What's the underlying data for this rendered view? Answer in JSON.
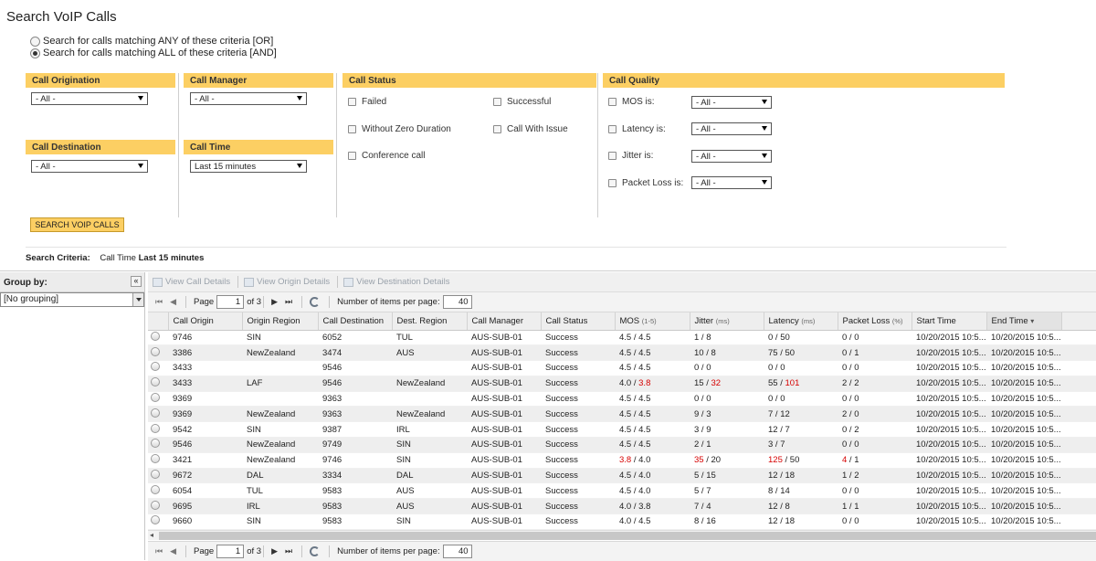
{
  "page": {
    "title": "Search VoIP Calls",
    "match_any": "Search for calls matching ANY of these criteria [OR]",
    "match_all": "Search for calls matching ALL of these criteria [AND]"
  },
  "filters": {
    "origination": {
      "label": "Call Origination",
      "value": "- All -"
    },
    "manager": {
      "label": "Call Manager",
      "value": "- All -"
    },
    "destination": {
      "label": "Call Destination",
      "value": "- All -"
    },
    "time": {
      "label": "Call Time",
      "value": "Last 15 minutes"
    },
    "status": {
      "label": "Call Status",
      "failed": "Failed",
      "successful": "Successful",
      "without_zero": "Without Zero Duration",
      "with_issue": "Call With Issue",
      "conference": "Conference call"
    },
    "quality": {
      "label": "Call Quality",
      "mos": "MOS is:",
      "latency": "Latency is:",
      "jitter": "Jitter is:",
      "packet_loss": "Packet Loss is:",
      "value": "- All -"
    },
    "search_button": "SEARCH VOIP CALLS",
    "criteria_label": "Search Criteria:",
    "criteria_field": "Call Time",
    "criteria_value": "Last 15 minutes"
  },
  "group_by": {
    "label": "Group by:",
    "value": "[No grouping]",
    "collapse": "«"
  },
  "toolbar": {
    "view_call": "View Call Details",
    "view_origin": "View Origin Details",
    "view_destination": "View Destination Details"
  },
  "pager": {
    "first": "⏮",
    "prev": "◀",
    "next": "▶",
    "last": "⏭",
    "page_label": "Page",
    "page_value": "1",
    "of_label": "of 3",
    "per_page_label": "Number of items per page:",
    "per_page_value": "40"
  },
  "columns": [
    {
      "label": "Call Origin",
      "unit": ""
    },
    {
      "label": "Origin Region",
      "unit": ""
    },
    {
      "label": "Call Destination",
      "unit": ""
    },
    {
      "label": "Dest. Region",
      "unit": ""
    },
    {
      "label": "Call Manager",
      "unit": ""
    },
    {
      "label": "Call Status",
      "unit": ""
    },
    {
      "label": "MOS",
      "unit": "(1-5)"
    },
    {
      "label": "Jitter",
      "unit": "(ms)"
    },
    {
      "label": "Latency",
      "unit": "(ms)"
    },
    {
      "label": "Packet Loss",
      "unit": "(%)"
    },
    {
      "label": "Start Time",
      "unit": ""
    },
    {
      "label": "End Time",
      "unit": ""
    }
  ],
  "rows": [
    {
      "origin": "9746",
      "origin_region": "SIN",
      "destination": "6052",
      "dest_region": "TUL",
      "manager": "AUS-SUB-01",
      "status": "Success",
      "mos_a": "4.5",
      "mos_b": "4.5",
      "mos_a_red": false,
      "mos_b_red": false,
      "jit_a": "1",
      "jit_b": "8",
      "jit_a_red": false,
      "jit_b_red": false,
      "lat_a": "0",
      "lat_b": "50",
      "lat_a_red": false,
      "lat_b_red": false,
      "pl_a": "0",
      "pl_b": "0",
      "pl_a_red": false,
      "pl_b_red": false,
      "start": "10/20/2015 10:5...",
      "end": "10/20/2015 10:5..."
    },
    {
      "origin": "3386",
      "origin_region": "NewZealand",
      "destination": "3474",
      "dest_region": "AUS",
      "manager": "AUS-SUB-01",
      "status": "Success",
      "mos_a": "4.5",
      "mos_b": "4.5",
      "mos_a_red": false,
      "mos_b_red": false,
      "jit_a": "10",
      "jit_b": "8",
      "jit_a_red": false,
      "jit_b_red": false,
      "lat_a": "75",
      "lat_b": "50",
      "lat_a_red": false,
      "lat_b_red": false,
      "pl_a": "0",
      "pl_b": "1",
      "pl_a_red": false,
      "pl_b_red": false,
      "start": "10/20/2015 10:5...",
      "end": "10/20/2015 10:5..."
    },
    {
      "origin": "3433",
      "origin_region": "",
      "destination": "9546",
      "dest_region": "",
      "manager": "AUS-SUB-01",
      "status": "Success",
      "mos_a": "4.5",
      "mos_b": "4.5",
      "mos_a_red": false,
      "mos_b_red": false,
      "jit_a": "0",
      "jit_b": "0",
      "jit_a_red": false,
      "jit_b_red": false,
      "lat_a": "0",
      "lat_b": "0",
      "lat_a_red": false,
      "lat_b_red": false,
      "pl_a": "0",
      "pl_b": "0",
      "pl_a_red": false,
      "pl_b_red": false,
      "start": "10/20/2015 10:5...",
      "end": "10/20/2015 10:5..."
    },
    {
      "origin": "3433",
      "origin_region": "LAF",
      "destination": "9546",
      "dest_region": "NewZealand",
      "manager": "AUS-SUB-01",
      "status": "Success",
      "mos_a": "4.0",
      "mos_b": "3.8",
      "mos_a_red": false,
      "mos_b_red": true,
      "jit_a": "15",
      "jit_b": "32",
      "jit_a_red": false,
      "jit_b_red": true,
      "lat_a": "55",
      "lat_b": "101",
      "lat_a_red": false,
      "lat_b_red": true,
      "pl_a": "2",
      "pl_b": "2",
      "pl_a_red": false,
      "pl_b_red": false,
      "start": "10/20/2015 10:5...",
      "end": "10/20/2015 10:5..."
    },
    {
      "origin": "9369",
      "origin_region": "",
      "destination": "9363",
      "dest_region": "",
      "manager": "AUS-SUB-01",
      "status": "Success",
      "mos_a": "4.5",
      "mos_b": "4.5",
      "mos_a_red": false,
      "mos_b_red": false,
      "jit_a": "0",
      "jit_b": "0",
      "jit_a_red": false,
      "jit_b_red": false,
      "lat_a": "0",
      "lat_b": "0",
      "lat_a_red": false,
      "lat_b_red": false,
      "pl_a": "0",
      "pl_b": "0",
      "pl_a_red": false,
      "pl_b_red": false,
      "start": "10/20/2015 10:5...",
      "end": "10/20/2015 10:5..."
    },
    {
      "origin": "9369",
      "origin_region": "NewZealand",
      "destination": "9363",
      "dest_region": "NewZealand",
      "manager": "AUS-SUB-01",
      "status": "Success",
      "mos_a": "4.5",
      "mos_b": "4.5",
      "mos_a_red": false,
      "mos_b_red": false,
      "jit_a": "9",
      "jit_b": "3",
      "jit_a_red": false,
      "jit_b_red": false,
      "lat_a": "7",
      "lat_b": "12",
      "lat_a_red": false,
      "lat_b_red": false,
      "pl_a": "2",
      "pl_b": "0",
      "pl_a_red": false,
      "pl_b_red": false,
      "start": "10/20/2015 10:5...",
      "end": "10/20/2015 10:5..."
    },
    {
      "origin": "9542",
      "origin_region": "SIN",
      "destination": "9387",
      "dest_region": "IRL",
      "manager": "AUS-SUB-01",
      "status": "Success",
      "mos_a": "4.5",
      "mos_b": "4.5",
      "mos_a_red": false,
      "mos_b_red": false,
      "jit_a": "3",
      "jit_b": "9",
      "jit_a_red": false,
      "jit_b_red": false,
      "lat_a": "12",
      "lat_b": "7",
      "lat_a_red": false,
      "lat_b_red": false,
      "pl_a": "0",
      "pl_b": "2",
      "pl_a_red": false,
      "pl_b_red": false,
      "start": "10/20/2015 10:5...",
      "end": "10/20/2015 10:5..."
    },
    {
      "origin": "9546",
      "origin_region": "NewZealand",
      "destination": "9749",
      "dest_region": "SIN",
      "manager": "AUS-SUB-01",
      "status": "Success",
      "mos_a": "4.5",
      "mos_b": "4.5",
      "mos_a_red": false,
      "mos_b_red": false,
      "jit_a": "2",
      "jit_b": "1",
      "jit_a_red": false,
      "jit_b_red": false,
      "lat_a": "3",
      "lat_b": "7",
      "lat_a_red": false,
      "lat_b_red": false,
      "pl_a": "0",
      "pl_b": "0",
      "pl_a_red": false,
      "pl_b_red": false,
      "start": "10/20/2015 10:5...",
      "end": "10/20/2015 10:5..."
    },
    {
      "origin": "3421",
      "origin_region": "NewZealand",
      "destination": "9746",
      "dest_region": "SIN",
      "manager": "AUS-SUB-01",
      "status": "Success",
      "mos_a": "3.8",
      "mos_b": "4.0",
      "mos_a_red": true,
      "mos_b_red": false,
      "jit_a": "35",
      "jit_b": "20",
      "jit_a_red": true,
      "jit_b_red": false,
      "lat_a": "125",
      "lat_b": "50",
      "lat_a_red": true,
      "lat_b_red": false,
      "pl_a": "4",
      "pl_b": "1",
      "pl_a_red": true,
      "pl_b_red": false,
      "start": "10/20/2015 10:5...",
      "end": "10/20/2015 10:5..."
    },
    {
      "origin": "9672",
      "origin_region": "DAL",
      "destination": "3334",
      "dest_region": "DAL",
      "manager": "AUS-SUB-01",
      "status": "Success",
      "mos_a": "4.5",
      "mos_b": "4.0",
      "mos_a_red": false,
      "mos_b_red": false,
      "jit_a": "5",
      "jit_b": "15",
      "jit_a_red": false,
      "jit_b_red": false,
      "lat_a": "12",
      "lat_b": "18",
      "lat_a_red": false,
      "lat_b_red": false,
      "pl_a": "1",
      "pl_b": "2",
      "pl_a_red": false,
      "pl_b_red": false,
      "start": "10/20/2015 10:5...",
      "end": "10/20/2015 10:5..."
    },
    {
      "origin": "6054",
      "origin_region": "TUL",
      "destination": "9583",
      "dest_region": "AUS",
      "manager": "AUS-SUB-01",
      "status": "Success",
      "mos_a": "4.5",
      "mos_b": "4.0",
      "mos_a_red": false,
      "mos_b_red": false,
      "jit_a": "5",
      "jit_b": "7",
      "jit_a_red": false,
      "jit_b_red": false,
      "lat_a": "8",
      "lat_b": "14",
      "lat_a_red": false,
      "lat_b_red": false,
      "pl_a": "0",
      "pl_b": "0",
      "pl_a_red": false,
      "pl_b_red": false,
      "start": "10/20/2015 10:5...",
      "end": "10/20/2015 10:5..."
    },
    {
      "origin": "9695",
      "origin_region": "IRL",
      "destination": "9583",
      "dest_region": "AUS",
      "manager": "AUS-SUB-01",
      "status": "Success",
      "mos_a": "4.0",
      "mos_b": "3.8",
      "mos_a_red": false,
      "mos_b_red": false,
      "jit_a": "7",
      "jit_b": "4",
      "jit_a_red": false,
      "jit_b_red": false,
      "lat_a": "12",
      "lat_b": "8",
      "lat_a_red": false,
      "lat_b_red": false,
      "pl_a": "1",
      "pl_b": "1",
      "pl_a_red": false,
      "pl_b_red": false,
      "start": "10/20/2015 10:5...",
      "end": "10/20/2015 10:5..."
    },
    {
      "origin": "9660",
      "origin_region": "SIN",
      "destination": "9583",
      "dest_region": "SIN",
      "manager": "AUS-SUB-01",
      "status": "Success",
      "mos_a": "4.0",
      "mos_b": "4.5",
      "mos_a_red": false,
      "mos_b_red": false,
      "jit_a": "8",
      "jit_b": "16",
      "jit_a_red": false,
      "jit_b_red": false,
      "lat_a": "12",
      "lat_b": "18",
      "lat_a_red": false,
      "lat_b_red": false,
      "pl_a": "0",
      "pl_b": "0",
      "pl_a_red": false,
      "pl_b_red": false,
      "start": "10/20/2015 10:5...",
      "end": "10/20/2015 10:5..."
    }
  ],
  "colors": {
    "accent": "#fccf63",
    "alert": "#d60000"
  },
  "scroll": {
    "left": "◂"
  },
  "sort": {
    "indicator": "▾"
  }
}
